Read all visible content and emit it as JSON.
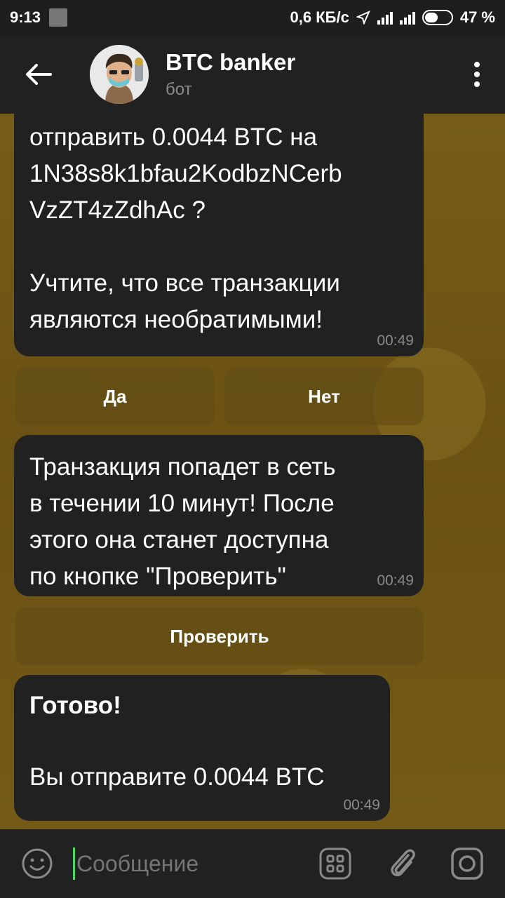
{
  "status_bar": {
    "time": "9:13",
    "net_speed": "0,6 КБ/с",
    "battery": "47 %"
  },
  "header": {
    "title": "BTC banker",
    "subtitle": "бот"
  },
  "messages": [
    {
      "lines": [
        "отправить 0.0044 BTC на",
        "1N38s8k1bfau2KodbzNCerb",
        "VzZT4zZdhAc ?",
        "",
        "Учтите, что все транзакции",
        "являются необратимыми!"
      ],
      "time": "00:49"
    },
    {
      "lines": [
        "Транзакция попадет в сеть",
        "в течении 10 минут! После",
        "этого она станет доступна",
        "по кнопке \"Проверить\""
      ],
      "time": "00:49"
    },
    {
      "title": "Готово!",
      "body": "Вы отправите 0.0044 BTC",
      "time": "00:49"
    }
  ],
  "keyboard": {
    "yes": "Да",
    "no": "Нет",
    "check": "Проверить"
  },
  "input": {
    "placeholder": "Сообщение"
  }
}
